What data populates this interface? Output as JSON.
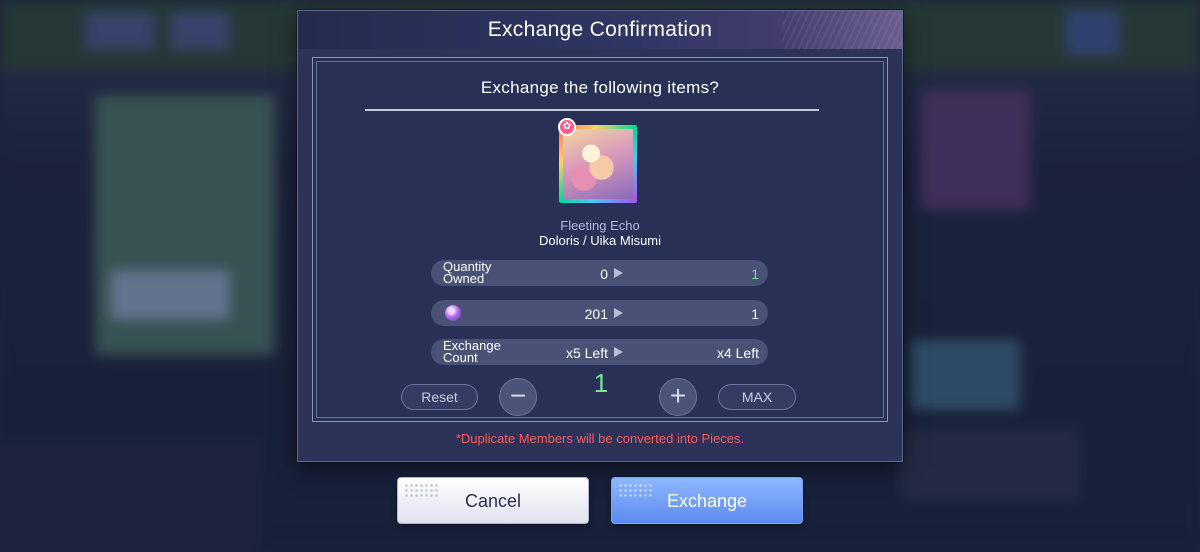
{
  "dialog": {
    "title": "Exchange Confirmation",
    "question": "Exchange the following items?"
  },
  "item": {
    "rarity_icon": "star-icon",
    "name": "Fleeting Echo",
    "member": "Doloris / Uika Misumi"
  },
  "rows": [
    {
      "label": "Quantity Owned",
      "from": "0",
      "to": "1",
      "to_color": "#6fe58f"
    },
    {
      "icon": "gem-icon",
      "from": "201",
      "to": "1"
    },
    {
      "label": "Exchange Count",
      "from": "x5 Left",
      "to": "x4 Left"
    }
  ],
  "controls": {
    "reset_label": "Reset",
    "minus_symbol": "−",
    "quantity": "1",
    "plus_symbol": "+",
    "max_label": "MAX"
  },
  "warning": "*Duplicate Members will be converted into Pieces.",
  "buttons": {
    "cancel": "Cancel",
    "exchange": "Exchange"
  },
  "colors": {
    "accent_green": "#6fe58f",
    "warning_red": "#ff5a5a",
    "exchange_blue": "#5d8af0"
  }
}
